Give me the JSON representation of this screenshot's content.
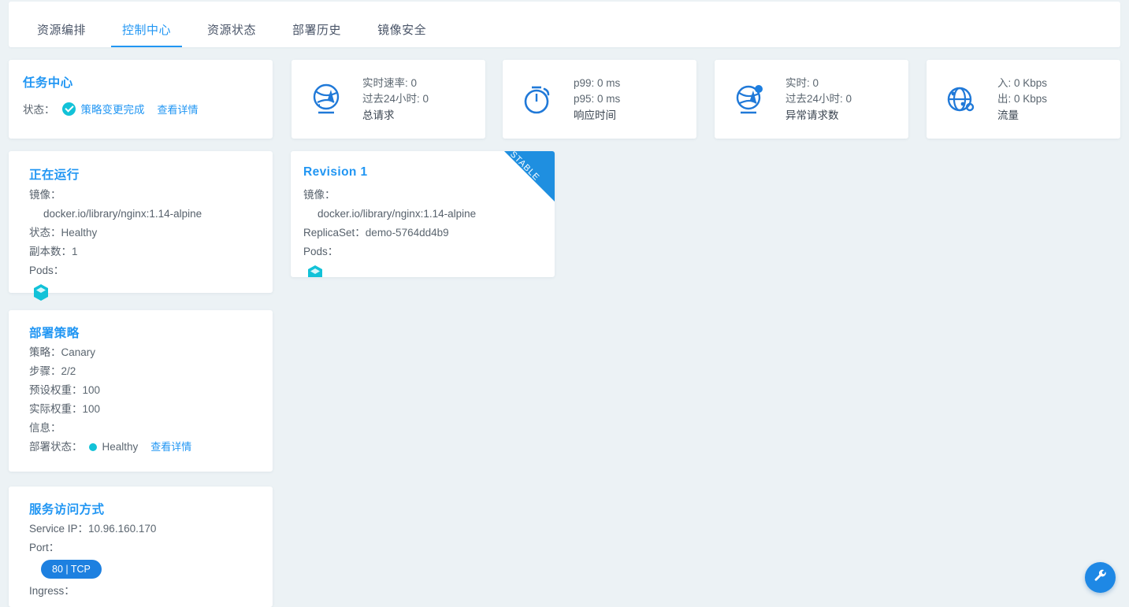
{
  "theme": {
    "page_bg": "#ecf2f5",
    "card_bg": "#ffffff",
    "accent_blue": "#2196f3",
    "ribbon_blue": "#1f8fe0",
    "badge_blue": "#1d80e0",
    "teal": "#12c2d8",
    "text_gray": "#56606b"
  },
  "tabs": [
    {
      "label": "资源编排",
      "active": false
    },
    {
      "label": "控制中心",
      "active": true
    },
    {
      "label": "资源状态",
      "active": false
    },
    {
      "label": "部署历史",
      "active": false
    },
    {
      "label": "镜像安全",
      "active": false
    }
  ],
  "task_center": {
    "title": "任务中心",
    "status_label": "状态：",
    "status_icon": "check-circle-icon",
    "status_text": "策略变更完成",
    "detail_link": "查看详情"
  },
  "metrics": [
    {
      "icon": "network-globe-icon",
      "line1": "实时速率: 0",
      "line2": "过去24小时: 0",
      "line3": "总请求"
    },
    {
      "icon": "stopwatch-icon",
      "line1": "p99: 0 ms",
      "line2": "p95: 0 ms",
      "line3": "响应时间"
    },
    {
      "icon": "network-globe-alert-icon",
      "line1": "实时: 0",
      "line2": "过去24小时: 0",
      "line3": "异常请求数"
    },
    {
      "icon": "globe-traffic-icon",
      "line1": "入: 0 Kbps",
      "line2": "出: 0 Kbps",
      "line3": "流量"
    }
  ],
  "running": {
    "title": "正在运行",
    "image_label": "镜像：",
    "image_value": "docker.io/library/nginx:1.14-alpine",
    "status_label": "状态：",
    "status_value": "Healthy",
    "replicas_label": "副本数：",
    "replicas_value": "1",
    "pods_label": "Pods：",
    "pod_icon": "pod-cube-icon"
  },
  "revision": {
    "title": "Revision 1",
    "ribbon": "STABLE",
    "image_label": "镜像：",
    "image_value": "docker.io/library/nginx:1.14-alpine",
    "replicaset_label": "ReplicaSet：",
    "replicaset_value": "demo-5764dd4b9",
    "pods_label": "Pods：",
    "pod_icon": "pod-cube-icon"
  },
  "strategy": {
    "title": "部署策略",
    "strategy_label": "策略：",
    "strategy_value": "Canary",
    "step_label": "步骤：",
    "step_value": "2/2",
    "preset_weight_label": "预设权重：",
    "preset_weight_value": "100",
    "actual_weight_label": "实际权重：",
    "actual_weight_value": "100",
    "message_label": "信息：",
    "message_value": "",
    "deploy_status_label": "部署状态：",
    "deploy_status_value": "Healthy",
    "detail_link": "查看详情"
  },
  "service": {
    "title": "服务访问方式",
    "service_ip_label": "Service IP：",
    "service_ip_value": "10.96.160.170",
    "port_label": "Port：",
    "port_badge": "80 | TCP",
    "ingress_label": "Ingress："
  },
  "fab": {
    "icon": "wrench-icon"
  }
}
